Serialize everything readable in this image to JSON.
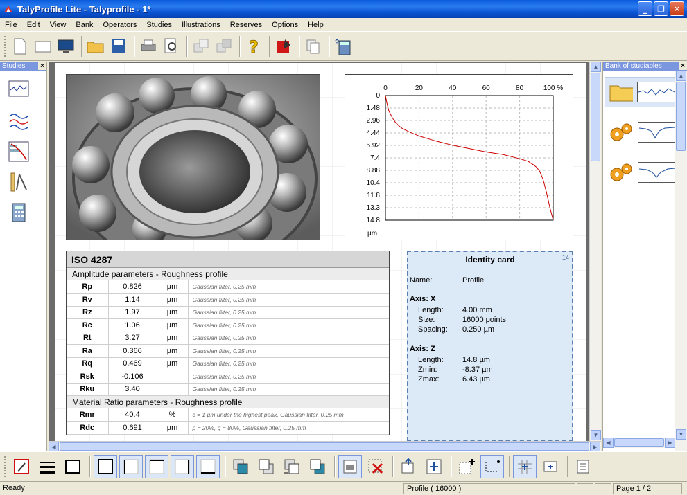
{
  "window": {
    "title": "TalyProfile Lite - Talyprofile - 1*"
  },
  "menu": [
    "File",
    "Edit",
    "View",
    "Bank",
    "Operators",
    "Studies",
    "Illustrations",
    "Reserves",
    "Options",
    "Help"
  ],
  "left_panel": {
    "title": "Studies",
    "close": "×"
  },
  "right_panel": {
    "title": "Bank of studiables",
    "close": "×"
  },
  "chart_data": {
    "type": "line",
    "title": "",
    "x_ticks": [
      "0",
      "20",
      "40",
      "60",
      "80",
      "100 %"
    ],
    "y_ticks": [
      "0",
      "1.48",
      "2.96",
      "4.44",
      "5.92",
      "7.4",
      "8.88",
      "10.4",
      "11.8",
      "13.3",
      "14.8"
    ],
    "ylabel": "µm",
    "xlim": [
      0,
      100
    ],
    "ylim": [
      0,
      14.8
    ],
    "grid": true,
    "series": [
      {
        "color": "#cc0000",
        "x": [
          0,
          1,
          2,
          4,
          6,
          8,
          10,
          14,
          20,
          30,
          40,
          50,
          60,
          70,
          80,
          85,
          88,
          90,
          92,
          94,
          96,
          98,
          100
        ],
        "y": [
          0,
          1,
          1.8,
          2.6,
          3.2,
          3.6,
          3.9,
          4.3,
          4.8,
          5.4,
          5.9,
          6.3,
          6.7,
          7.0,
          7.5,
          7.8,
          8.2,
          8.5,
          9.0,
          10.0,
          11.5,
          13.3,
          14.8
        ]
      }
    ]
  },
  "iso": {
    "title": "ISO 4287",
    "amp_header": "Amplitude parameters - Roughness profile",
    "amp_rows": [
      {
        "name": "Rp",
        "value": "0.826",
        "unit": "µm",
        "comment": "Gaussian filter, 0.25 mm"
      },
      {
        "name": "Rv",
        "value": "1.14",
        "unit": "µm",
        "comment": "Gaussian filter, 0.25 mm"
      },
      {
        "name": "Rz",
        "value": "1.97",
        "unit": "µm",
        "comment": "Gaussian filter, 0.25 mm"
      },
      {
        "name": "Rc",
        "value": "1.06",
        "unit": "µm",
        "comment": "Gaussian filter, 0.25 mm"
      },
      {
        "name": "Rt",
        "value": "3.27",
        "unit": "µm",
        "comment": "Gaussian filter, 0.25 mm"
      },
      {
        "name": "Ra",
        "value": "0.366",
        "unit": "µm",
        "comment": "Gaussian filter, 0.25 mm"
      },
      {
        "name": "Rq",
        "value": "0.469",
        "unit": "µm",
        "comment": "Gaussian filter, 0.25 mm"
      },
      {
        "name": "Rsk",
        "value": "-0.106",
        "unit": "",
        "comment": "Gaussian filter, 0.25 mm"
      },
      {
        "name": "Rku",
        "value": "3.40",
        "unit": "",
        "comment": "Gaussian filter, 0.25 mm"
      }
    ],
    "mat_header": "Material Ratio parameters - Roughness profile",
    "mat_rows": [
      {
        "name": "Rmr",
        "value": "40.4",
        "unit": "%",
        "comment": "c = 1 µm under the highest peak, Gaussian filter, 0.25 mm"
      },
      {
        "name": "Rdc",
        "value": "0.691",
        "unit": "µm",
        "comment": "p = 20%, q = 80%, Gaussian filter, 0.25 mm"
      }
    ]
  },
  "identity": {
    "title": "Identity card",
    "num": "14",
    "name_label": "Name:",
    "name_value": "Profile",
    "axis_x": "Axis: X",
    "x_rows": [
      {
        "k": "Length:",
        "v": "4.00 mm"
      },
      {
        "k": "Size:",
        "v": "16000 points"
      },
      {
        "k": "Spacing:",
        "v": "0.250 µm"
      }
    ],
    "axis_z": "Axis: Z",
    "z_rows": [
      {
        "k": "Length:",
        "v": "14.8 µm"
      },
      {
        "k": "Zmin:",
        "v": "-8.37 µm"
      },
      {
        "k": "Zmax:",
        "v": "6.43 µm"
      }
    ]
  },
  "status": {
    "left": "Ready",
    "profile": "Profile ( 16000 )",
    "page": "Page 1 / 2"
  }
}
